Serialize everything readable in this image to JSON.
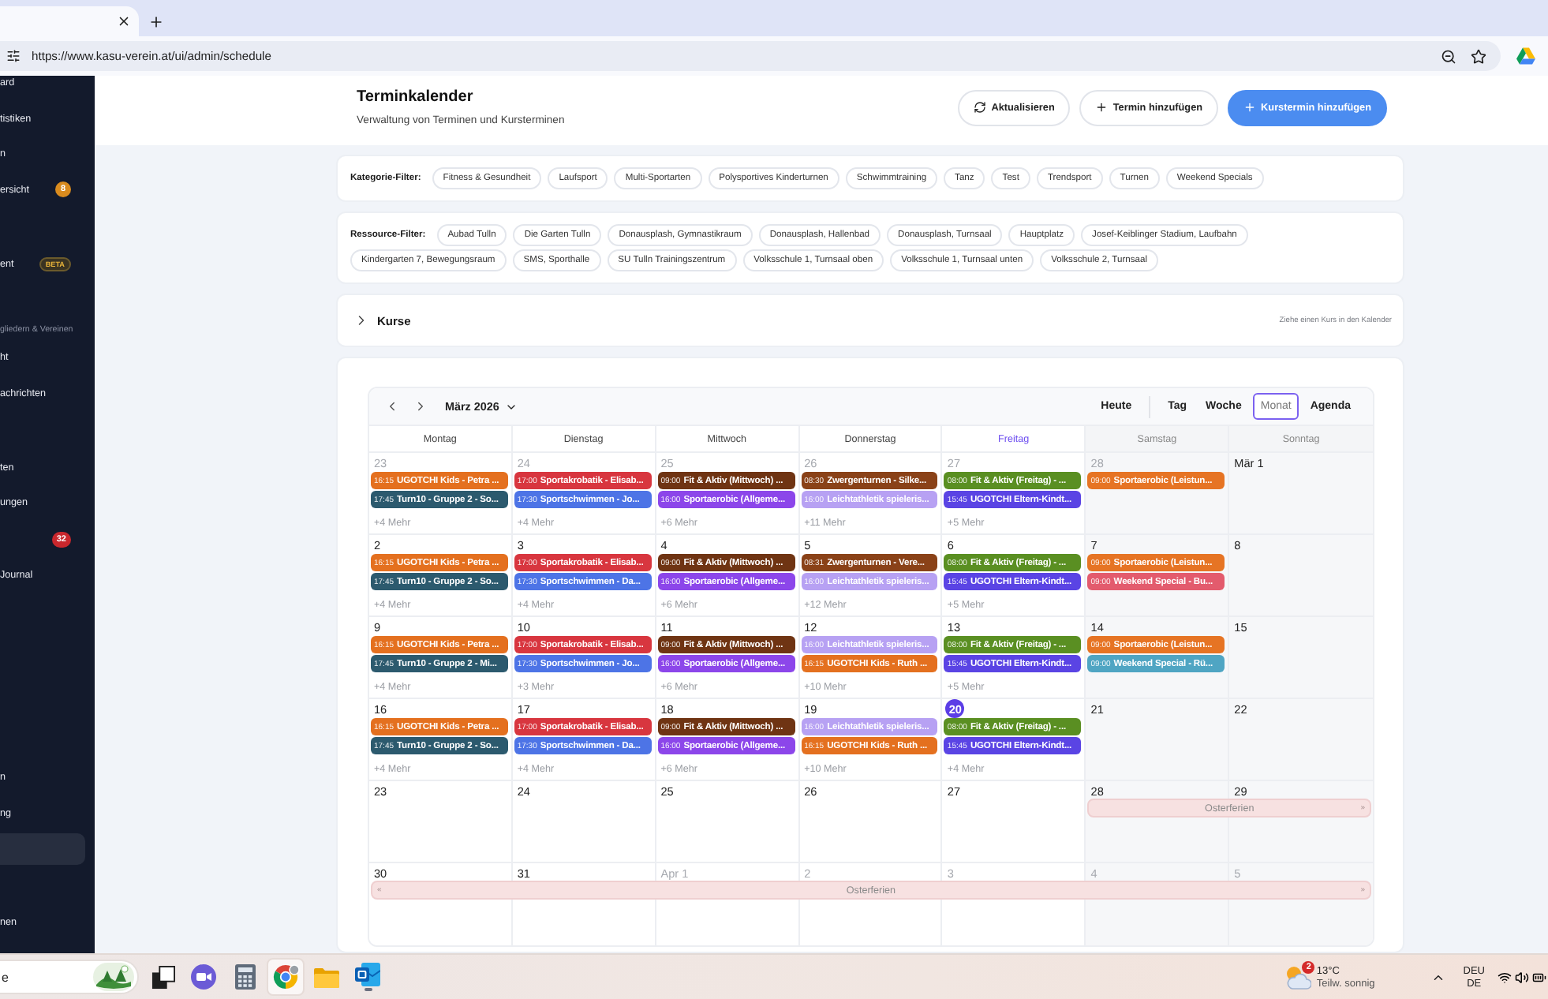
{
  "browser": {
    "url": "https://www.kasu-verein.at/ui/admin/schedule"
  },
  "sidebar": {
    "top_groups": [
      {
        "items": [
          {
            "label": "ard",
            "selected": false
          },
          {
            "label": "tistiken",
            "selected": false
          },
          {
            "label": "n",
            "selected": false
          },
          {
            "label": "ersicht",
            "selected": false,
            "badge": {
              "text": "8",
              "kind": "count"
            }
          }
        ]
      },
      {
        "items": [
          {
            "label": "ent",
            "selected": false,
            "badge": {
              "text": "BETA",
              "kind": "beta"
            }
          }
        ]
      },
      {
        "heading": "gliedern & Vereinen",
        "items": [
          {
            "label": "ht",
            "selected": false
          },
          {
            "label": "achrichten",
            "selected": false
          }
        ]
      },
      {
        "items": [
          {
            "label": "ten",
            "selected": false
          },
          {
            "label": "ungen",
            "selected": false
          },
          {
            "selected": false,
            "badge": {
              "text": "32",
              "kind": "alert"
            }
          },
          {
            "label": "Journal",
            "selected": false
          }
        ]
      }
    ],
    "bottom_groups": [
      {
        "items": [
          {
            "label": "n",
            "selected": false
          },
          {
            "label": "ng",
            "selected": false
          },
          {
            "selected": true
          }
        ]
      },
      {
        "items": [
          {
            "label": "nen",
            "selected": false
          }
        ]
      }
    ]
  },
  "header": {
    "title": "Terminkalender",
    "subtitle": "Verwaltung von Terminen und Kursterminen",
    "buttons": [
      {
        "label": "Aktualisieren",
        "kind": "refresh"
      },
      {
        "label": "Termin hinzufügen",
        "kind": "add"
      },
      {
        "label": "Kurstermin hinzufügen",
        "kind": "primary"
      }
    ]
  },
  "category_filter": {
    "label": "Kategorie-Filter:",
    "chips": [
      {
        "label": "Fitness & Gesundheit",
        "selected": false
      },
      {
        "label": "Laufsport",
        "selected": false
      },
      {
        "label": "Multi-Sportarten",
        "selected": false
      },
      {
        "label": "Polysportives Kinderturnen",
        "selected": false
      },
      {
        "label": "Schwimmtraining",
        "selected": false
      },
      {
        "label": "Tanz",
        "selected": false
      },
      {
        "label": "Test",
        "selected": false
      },
      {
        "label": "Trendsport",
        "selected": false
      },
      {
        "label": "Turnen",
        "selected": false
      },
      {
        "label": "Weekend Specials",
        "selected": false
      }
    ]
  },
  "resource_filter": {
    "label": "Ressource-Filter:",
    "chips": [
      {
        "label": "Aubad Tulln",
        "selected": false
      },
      {
        "label": "Die Garten Tulln",
        "selected": false
      },
      {
        "label": "Donausplash, Gymnastikraum",
        "selected": false
      },
      {
        "label": "Donausplash, Hallenbad",
        "selected": false
      },
      {
        "label": "Donausplash, Turnsaal",
        "selected": false
      },
      {
        "label": "Hauptplatz",
        "selected": false
      },
      {
        "label": "Josef-Keiblinger Stadium, Laufbahn",
        "selected": false
      },
      {
        "label": "Kindergarten 7, Bewegungsraum",
        "selected": false
      },
      {
        "label": "SMS, Sporthalle",
        "selected": false
      },
      {
        "label": "SU Tulln Trainingszentrum",
        "selected": false
      },
      {
        "label": "Volksschule 1, Turnsaal oben",
        "selected": false
      },
      {
        "label": "Volksschule 1, Turnsaal unten",
        "selected": false
      },
      {
        "label": "Volksschule 2, Turnsaal",
        "selected": false
      }
    ]
  },
  "courses": {
    "title": "Kurse",
    "expanded": false,
    "hint": "Ziehe einen Kurs in den Kalender"
  },
  "calendar": {
    "month": "März 2026",
    "today_button": "Heute",
    "views": [
      {
        "label": "Tag",
        "selected": false
      },
      {
        "label": "Woche",
        "selected": false
      },
      {
        "label": "Monat",
        "selected": true
      },
      {
        "label": "Agenda",
        "selected": false
      }
    ],
    "columns": [
      {
        "label": "Montag",
        "current": false,
        "weekend": false
      },
      {
        "label": "Dienstag",
        "current": false,
        "weekend": false
      },
      {
        "label": "Mittwoch",
        "current": false,
        "weekend": false
      },
      {
        "label": "Donnerstag",
        "current": false,
        "weekend": false
      },
      {
        "label": "Freitag",
        "current": true,
        "weekend": false
      },
      {
        "label": "Samstag",
        "current": false,
        "weekend": true
      },
      {
        "label": "Sonntag",
        "current": false,
        "weekend": true
      }
    ],
    "weeks": [
      {
        "days": [
          {
            "date": "23",
            "muted": true,
            "today": false,
            "events": [
              {
                "time": "16:15",
                "title": "UGOTCHI Kids - Petra ...",
                "color": "#e4701f"
              },
              {
                "time": "17:45",
                "title": "Turn10 - Gruppe 2 - So...",
                "color": "#2c5a6e"
              }
            ],
            "more": "+4 Mehr"
          },
          {
            "date": "24",
            "muted": true,
            "today": false,
            "events": [
              {
                "time": "17:00",
                "title": "Sportakrobatik - Elisab...",
                "color": "#d8363f"
              },
              {
                "time": "17:30",
                "title": "Sportschwimmen - Jo...",
                "color": "#4d74e6"
              }
            ],
            "more": "+4 Mehr"
          },
          {
            "date": "25",
            "muted": true,
            "today": false,
            "events": [
              {
                "time": "09:00",
                "title": "Fit & Aktiv (Mittwoch) ...",
                "color": "#6f3413"
              },
              {
                "time": "16:00",
                "title": "Sportaerobic (Allgeme...",
                "color": "#8c46ea"
              }
            ],
            "more": "+6 Mehr"
          },
          {
            "date": "26",
            "muted": true,
            "today": false,
            "events": [
              {
                "time": "08:30",
                "title": "Zwergenturnen - Silke...",
                "color": "#8a4218"
              },
              {
                "time": "16:00",
                "title": "Leichtathletik spieleris...",
                "color": "#b7a1f3"
              }
            ],
            "more": "+11 Mehr"
          },
          {
            "date": "27",
            "muted": true,
            "today": false,
            "events": [
              {
                "time": "08:00",
                "title": "Fit & Aktiv (Freitag) - ...",
                "color": "#5a8f22"
              },
              {
                "time": "15:45",
                "title": "UGOTCHI Eltern-Kindt...",
                "color": "#5a44e4"
              }
            ],
            "more": "+5 Mehr"
          },
          {
            "date": "28",
            "muted": true,
            "today": false,
            "events": [
              {
                "time": "09:00",
                "title": "Sportaerobic (Leistun...",
                "color": "#e67424"
              }
            ]
          },
          {
            "date": "Mär 1",
            "muted": false,
            "today": false
          }
        ]
      },
      {
        "days": [
          {
            "date": "2",
            "muted": false,
            "today": false,
            "events": [
              {
                "time": "16:15",
                "title": "UGOTCHI Kids - Petra ...",
                "color": "#e4701f"
              },
              {
                "time": "17:45",
                "title": "Turn10 - Gruppe 2 - So...",
                "color": "#2c5a6e"
              }
            ],
            "more": "+4 Mehr"
          },
          {
            "date": "3",
            "muted": false,
            "today": false,
            "events": [
              {
                "time": "17:00",
                "title": "Sportakrobatik - Elisab...",
                "color": "#d8363f"
              },
              {
                "time": "17:30",
                "title": "Sportschwimmen - Da...",
                "color": "#4d74e6"
              }
            ],
            "more": "+4 Mehr"
          },
          {
            "date": "4",
            "muted": false,
            "today": false,
            "events": [
              {
                "time": "09:00",
                "title": "Fit & Aktiv (Mittwoch) ...",
                "color": "#6f3413"
              },
              {
                "time": "16:00",
                "title": "Sportaerobic (Allgeme...",
                "color": "#8c46ea"
              }
            ],
            "more": "+6 Mehr"
          },
          {
            "date": "5",
            "muted": false,
            "today": false,
            "events": [
              {
                "time": "08:31",
                "title": "Zwergenturnen - Vere...",
                "color": "#8a4218"
              },
              {
                "time": "16:00",
                "title": "Leichtathletik spieleris...",
                "color": "#b7a1f3"
              }
            ],
            "more": "+12 Mehr"
          },
          {
            "date": "6",
            "muted": false,
            "today": false,
            "events": [
              {
                "time": "08:00",
                "title": "Fit & Aktiv (Freitag) - ...",
                "color": "#5a8f22"
              },
              {
                "time": "15:45",
                "title": "UGOTCHI Eltern-Kindt...",
                "color": "#5a44e4"
              }
            ],
            "more": "+5 Mehr"
          },
          {
            "date": "7",
            "muted": false,
            "today": false,
            "events": [
              {
                "time": "09:00",
                "title": "Sportaerobic (Leistun...",
                "color": "#e67424"
              },
              {
                "time": "09:00",
                "title": "Weekend Special - Bu...",
                "color": "#e35b6d"
              }
            ]
          },
          {
            "date": "8",
            "muted": false,
            "today": false
          }
        ]
      },
      {
        "days": [
          {
            "date": "9",
            "muted": false,
            "today": false,
            "events": [
              {
                "time": "16:15",
                "title": "UGOTCHI Kids - Petra ...",
                "color": "#e4701f"
              },
              {
                "time": "17:45",
                "title": "Turn10 - Gruppe 2 - Mi...",
                "color": "#2c5a6e"
              }
            ],
            "more": "+4 Mehr"
          },
          {
            "date": "10",
            "muted": false,
            "today": false,
            "events": [
              {
                "time": "17:00",
                "title": "Sportakrobatik - Elisab...",
                "color": "#d8363f"
              },
              {
                "time": "17:30",
                "title": "Sportschwimmen - Jo...",
                "color": "#4d74e6"
              }
            ],
            "more": "+3 Mehr"
          },
          {
            "date": "11",
            "muted": false,
            "today": false,
            "events": [
              {
                "time": "09:00",
                "title": "Fit & Aktiv (Mittwoch) ...",
                "color": "#6f3413"
              },
              {
                "time": "16:00",
                "title": "Sportaerobic (Allgeme...",
                "color": "#8c46ea"
              }
            ],
            "more": "+6 Mehr"
          },
          {
            "date": "12",
            "muted": false,
            "today": false,
            "events": [
              {
                "time": "16:00",
                "title": "Leichtathletik spieleris...",
                "color": "#b7a1f3"
              },
              {
                "time": "16:15",
                "title": "UGOTCHI Kids - Ruth ...",
                "color": "#e4701f"
              }
            ],
            "more": "+10 Mehr"
          },
          {
            "date": "13",
            "muted": false,
            "today": false,
            "events": [
              {
                "time": "08:00",
                "title": "Fit & Aktiv (Freitag) - ...",
                "color": "#5a8f22"
              },
              {
                "time": "15:45",
                "title": "UGOTCHI Eltern-Kindt...",
                "color": "#5a44e4"
              }
            ],
            "more": "+5 Mehr"
          },
          {
            "date": "14",
            "muted": false,
            "today": false,
            "events": [
              {
                "time": "09:00",
                "title": "Sportaerobic (Leistun...",
                "color": "#e67424"
              },
              {
                "time": "09:00",
                "title": "Weekend Special - Rü...",
                "color": "#4fa5c3"
              }
            ]
          },
          {
            "date": "15",
            "muted": false,
            "today": false
          }
        ]
      },
      {
        "days": [
          {
            "date": "16",
            "muted": false,
            "today": false,
            "events": [
              {
                "time": "16:15",
                "title": "UGOTCHI Kids - Petra ...",
                "color": "#e4701f"
              },
              {
                "time": "17:45",
                "title": "Turn10 - Gruppe 2 - So...",
                "color": "#2c5a6e"
              }
            ],
            "more": "+4 Mehr"
          },
          {
            "date": "17",
            "muted": false,
            "today": false,
            "events": [
              {
                "time": "17:00",
                "title": "Sportakrobatik - Elisab...",
                "color": "#d8363f"
              },
              {
                "time": "17:30",
                "title": "Sportschwimmen - Da...",
                "color": "#4d74e6"
              }
            ],
            "more": "+4 Mehr"
          },
          {
            "date": "18",
            "muted": false,
            "today": false,
            "events": [
              {
                "time": "09:00",
                "title": "Fit & Aktiv (Mittwoch) ...",
                "color": "#6f3413"
              },
              {
                "time": "16:00",
                "title": "Sportaerobic (Allgeme...",
                "color": "#8c46ea"
              }
            ],
            "more": "+6 Mehr"
          },
          {
            "date": "19",
            "muted": false,
            "today": false,
            "events": [
              {
                "time": "16:00",
                "title": "Leichtathletik spieleris...",
                "color": "#b7a1f3"
              },
              {
                "time": "16:15",
                "title": "UGOTCHI Kids - Ruth ...",
                "color": "#e4701f"
              }
            ],
            "more": "+10 Mehr"
          },
          {
            "date": "20",
            "muted": false,
            "today": true,
            "events": [
              {
                "time": "08:00",
                "title": "Fit & Aktiv (Freitag) - ...",
                "color": "#5a8f22"
              },
              {
                "time": "15:45",
                "title": "UGOTCHI Eltern-Kindt...",
                "color": "#5a44e4"
              }
            ],
            "more": "+4 Mehr"
          },
          {
            "date": "21",
            "muted": false,
            "today": false
          },
          {
            "date": "22",
            "muted": false,
            "today": false
          }
        ]
      },
      {
        "days": [
          {
            "date": "23",
            "muted": false,
            "today": false
          },
          {
            "date": "24",
            "muted": false,
            "today": false
          },
          {
            "date": "25",
            "muted": false,
            "today": false
          },
          {
            "date": "26",
            "muted": false,
            "today": false
          },
          {
            "date": "27",
            "muted": false,
            "today": false
          },
          {
            "date": "28",
            "muted": false,
            "today": false,
            "banner": {
              "label": "Osterferien",
              "end_mark": "»"
            }
          },
          {
            "date": "29",
            "muted": false,
            "today": false
          }
        ]
      },
      {
        "days": [
          {
            "date": "30",
            "muted": false,
            "today": false,
            "banner": {
              "label": "Osterferien",
              "start_mark": "«",
              "end_mark": "»"
            }
          },
          {
            "date": "31",
            "muted": false,
            "today": false
          },
          {
            "date": "Apr 1",
            "muted": true,
            "today": false
          },
          {
            "date": "2",
            "muted": true,
            "today": false
          },
          {
            "date": "3",
            "muted": true,
            "today": false
          },
          {
            "date": "4",
            "muted": true,
            "today": false
          },
          {
            "date": "5",
            "muted": true,
            "today": false
          }
        ]
      }
    ]
  },
  "taskbar": {
    "search": {
      "placeholder": "e"
    },
    "apps": [
      {
        "kind": "task-view",
        "active": false,
        "running": false
      },
      {
        "kind": "chat",
        "active": false,
        "running": false
      },
      {
        "kind": "calculator",
        "active": false,
        "running": false
      },
      {
        "kind": "browser",
        "active": true,
        "running": false
      },
      {
        "kind": "files",
        "active": false,
        "running": false
      },
      {
        "kind": "mail",
        "active": false,
        "running": true
      }
    ],
    "weather": {
      "badge": "2",
      "temperature": "13°C",
      "condition": "Teilw. sonnig"
    },
    "language": {
      "code": "DEU",
      "layout": "DE"
    }
  }
}
